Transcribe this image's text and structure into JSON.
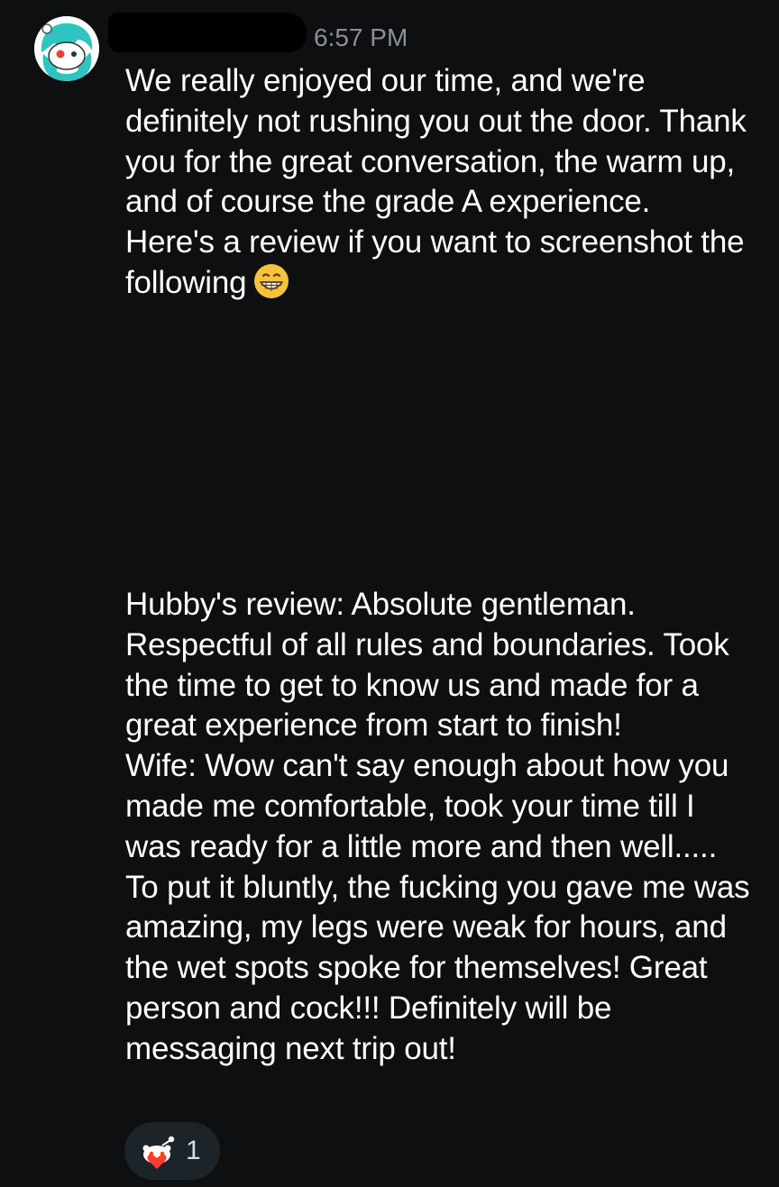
{
  "message": {
    "timestamp": "6:57 PM",
    "avatar_icon": "snoo-avatar-icon",
    "username_redacted": true,
    "paragraph_1": "We really enjoyed our time, and we're definitely not rushing you out the door. Thank you for the great conversation, the warm up, and of course the grade A experience.\nHere's a review if you want to screenshot the following",
    "paragraph_1_emoji": "grinning-face-emoji",
    "paragraph_2": "Hubby's review: Absolute gentleman. Respectful of all rules and boundaries. Took the time to get to know us and made for a great experience from start to finish!\nWife: Wow can't say enough about how you made me comfortable, took your time till I was ready for a little more and then well..... To put it bluntly, the fucking you gave me was amazing, my legs were weak for hours, and the wet spots spoke for themselves! Great person and cock!!! Definitely will be messaging next trip out!"
  },
  "reaction": {
    "icon": "snoo-heart-reaction-icon",
    "count": "1"
  },
  "colors": {
    "background": "#0e0f11",
    "text": "#ffffff",
    "timestamp": "#8a9096",
    "reaction_pill": "#1c2429"
  }
}
